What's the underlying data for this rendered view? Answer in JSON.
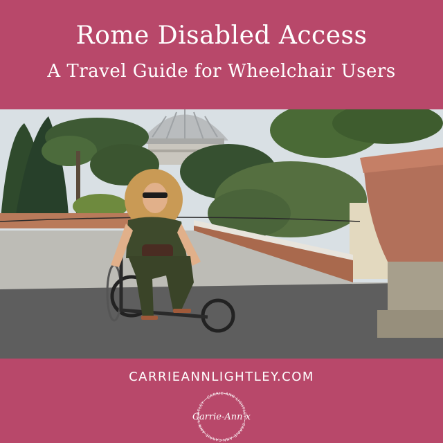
{
  "header": {
    "title": "Rome Disabled Access",
    "subtitle": "A Travel Guide for Wheelchair Users"
  },
  "photo": {
    "alt": "Woman in a wheelchair on a terrace overlooking the dome of St. Peter's Basilica in Rome"
  },
  "footer": {
    "website": "CARRIEANNLIGHTLEY.COM",
    "logo_text": "Carrie-Ann x",
    "logo_ring_text": "CARRIE-ANN LIGHTLEY · CARRIE-ANN LIGHTLEY · CARRIE-ANN LIGHTLEY ·"
  },
  "colors": {
    "brand_pink": "#b8486a",
    "text": "#ffffff"
  }
}
